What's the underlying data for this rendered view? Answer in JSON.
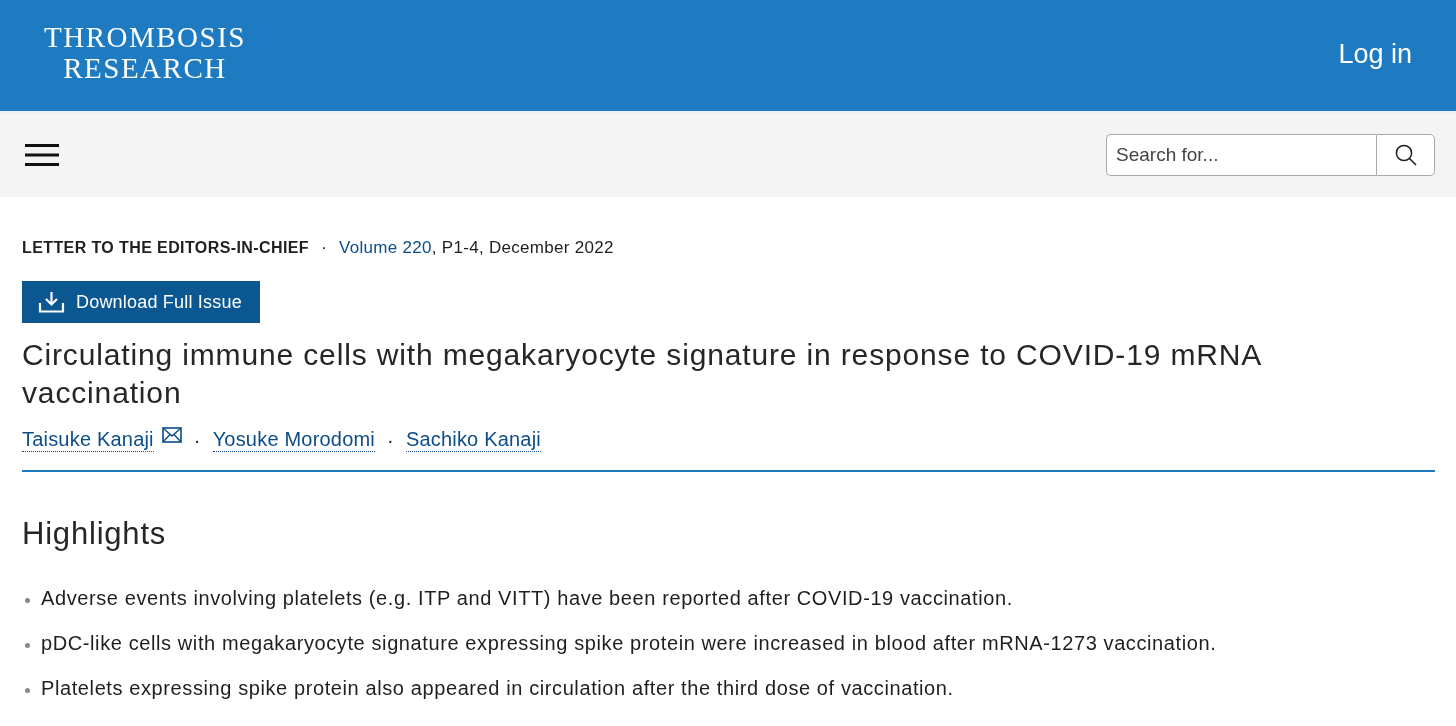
{
  "header": {
    "logo_lines": [
      "THROMBOSIS",
      "RESEARCH"
    ],
    "login": "Log in"
  },
  "nav": {
    "search": {
      "placeholder": "Search for..."
    }
  },
  "article": {
    "type_label": "LETTER TO THE EDITORS-IN-CHIEF",
    "separator": "·",
    "volume_link": "Volume 220",
    "details": ", P1-4, December 2022",
    "download_button": "Download Full Issue",
    "title": "Circulating immune cells with megakaryocyte signature in response to COVID-19 mRNA vaccination",
    "authors": [
      {
        "name": "Taisuke Kanaji",
        "corresponding": true
      },
      {
        "separator": "·",
        "name": "Yosuke Morodomi",
        "corresponding": false
      },
      {
        "separator": "·",
        "name": "Sachiko Kanaji",
        "corresponding": false
      }
    ]
  },
  "highlights": {
    "heading": "Highlights",
    "items": [
      "Adverse events involving platelets (e.g. ITP and VITT) have been reported after COVID-19 vaccination.",
      "pDC-like cells with megakaryocyte signature expressing spike protein were increased in blood after mRNA-1273 vaccination.",
      "Platelets expressing spike protein also appeared in circulation after the third dose of vaccination."
    ]
  }
}
